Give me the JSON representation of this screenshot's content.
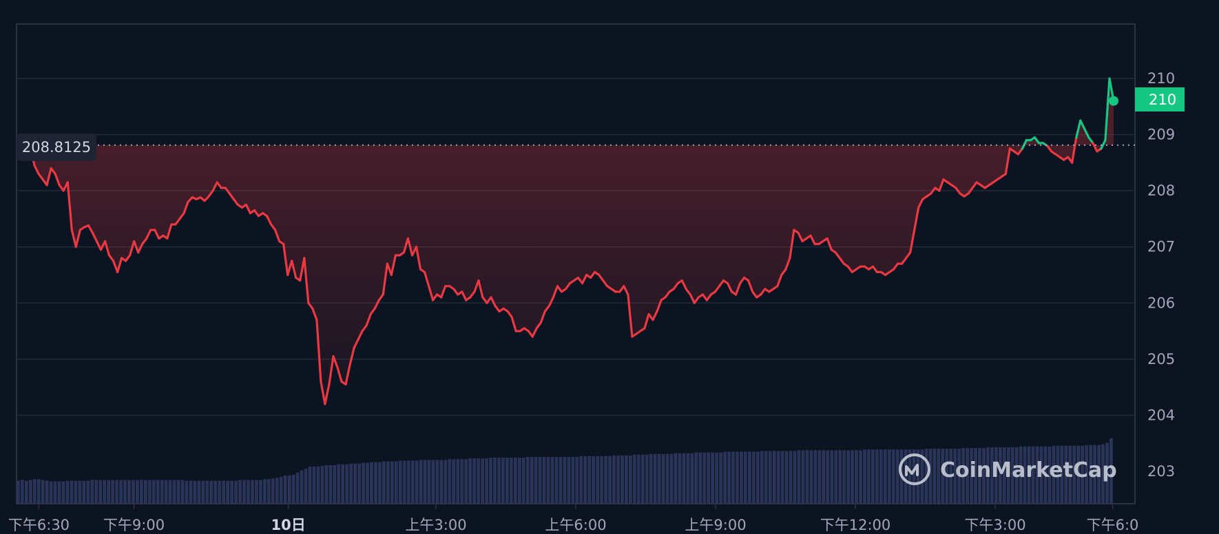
{
  "brand": {
    "name": "CoinMarketCap",
    "icon": "coinmarketcap-logo-icon"
  },
  "colors": {
    "background": "#0d1421",
    "grid": "#222a3a",
    "up": "#16c784",
    "down": "#ea3943",
    "volume": "#2a3358",
    "reference": "#a1a7bb",
    "label_bg": "#1e2433"
  },
  "chart_data": {
    "type": "line",
    "reference_value": 208.8125,
    "reference_label": "208.8125",
    "last_value": 209.6,
    "last_label": "210",
    "ylim": [
      202.4,
      210.9
    ],
    "yticks": [
      203,
      204,
      205,
      206,
      207,
      208,
      209,
      210
    ],
    "ytick_labels": [
      "203",
      "204",
      "205",
      "206",
      "207",
      "208",
      "209",
      "210"
    ],
    "x_tick_labels": [
      {
        "label": "下午6:30",
        "pos": 0.02,
        "bold": false
      },
      {
        "label": "下午9:00",
        "pos": 0.105,
        "bold": false
      },
      {
        "label": "10日",
        "pos": 0.243,
        "bold": true
      },
      {
        "label": "上午3:00",
        "pos": 0.375,
        "bold": false
      },
      {
        "label": "上午6:00",
        "pos": 0.5,
        "bold": false
      },
      {
        "label": "上午9:00",
        "pos": 0.625,
        "bold": false
      },
      {
        "label": "下午12:00",
        "pos": 0.75,
        "bold": false
      },
      {
        "label": "下午3:00",
        "pos": 0.875,
        "bold": false
      },
      {
        "label": "下午6:0",
        "pos": 0.98,
        "bold": false
      }
    ],
    "series": [
      {
        "values": [
          208.8,
          208.45,
          208.3,
          208.2,
          208.1,
          208.4,
          208.3,
          208.1,
          208.0,
          208.15,
          207.3,
          207.0,
          207.3,
          207.35,
          207.38,
          207.25,
          207.1,
          206.95,
          207.1,
          206.85,
          206.75,
          206.55,
          206.8,
          206.75,
          206.85,
          207.1,
          206.9,
          207.05,
          207.15,
          207.3,
          207.3,
          207.15,
          207.2,
          207.15,
          207.4,
          207.4,
          207.5,
          207.6,
          207.8,
          207.88,
          207.85,
          207.88,
          207.82,
          207.9,
          208.0,
          208.15,
          208.05,
          208.05,
          207.95,
          207.85,
          207.75,
          207.7,
          207.75,
          207.6,
          207.65,
          207.55,
          207.6,
          207.55,
          207.4,
          207.3,
          207.1,
          207.05,
          206.5,
          206.75,
          206.45,
          206.4,
          206.8,
          206.0,
          205.9,
          205.7,
          204.6,
          204.2,
          204.55,
          205.05,
          204.85,
          204.6,
          204.55,
          204.9,
          205.2,
          205.35,
          205.5,
          205.6,
          205.8,
          205.9,
          206.05,
          206.15,
          206.7,
          206.5,
          206.85,
          206.85,
          206.9,
          207.15,
          206.85,
          207.0,
          206.6,
          206.55,
          206.3,
          206.05,
          206.15,
          206.1,
          206.3,
          206.3,
          206.25,
          206.15,
          206.2,
          206.05,
          206.1,
          206.2,
          206.4,
          206.1,
          206.0,
          206.1,
          205.95,
          205.85,
          205.9,
          205.85,
          205.75,
          205.5,
          205.5,
          205.55,
          205.5,
          205.4,
          205.55,
          205.65,
          205.85,
          205.95,
          206.1,
          206.3,
          206.2,
          206.25,
          206.35,
          206.4,
          206.45,
          206.35,
          206.5,
          206.45,
          206.55,
          206.5,
          206.4,
          206.3,
          206.25,
          206.2,
          206.2,
          206.3,
          206.15,
          205.4,
          205.45,
          205.5,
          205.55,
          205.8,
          205.7,
          205.85,
          206.05,
          206.1,
          206.2,
          206.25,
          206.35,
          206.4,
          206.25,
          206.15,
          206.0,
          206.1,
          206.15,
          206.05,
          206.15,
          206.2,
          206.3,
          206.4,
          206.35,
          206.2,
          206.15,
          206.35,
          206.45,
          206.4,
          206.2,
          206.1,
          206.15,
          206.25,
          206.2,
          206.25,
          206.3,
          206.5,
          206.6,
          206.8,
          207.3,
          207.25,
          207.1,
          207.15,
          207.2,
          207.05,
          207.05,
          207.1,
          207.15,
          206.95,
          206.9,
          206.8,
          206.7,
          206.65,
          206.55,
          206.6,
          206.65,
          206.65,
          206.6,
          206.65,
          206.55,
          206.55,
          206.5,
          206.55,
          206.6,
          206.7,
          206.7,
          206.8,
          206.9,
          207.3,
          207.7,
          207.85,
          207.9,
          207.95,
          208.05,
          208.0,
          208.2,
          208.15,
          208.1,
          208.05,
          207.95,
          207.9,
          207.95,
          208.05,
          208.15,
          208.1,
          208.05,
          208.1,
          208.15,
          208.2,
          208.25,
          208.3,
          208.75,
          208.7,
          208.65,
          208.75,
          208.9,
          208.9,
          208.95,
          208.85,
          208.85,
          208.8,
          208.7,
          208.65,
          208.6,
          208.55,
          208.6,
          208.5,
          208.95,
          209.25,
          209.1,
          208.95,
          208.85,
          208.7,
          208.75,
          208.9,
          210.0,
          209.6
        ]
      }
    ],
    "volume": [
      0.31,
      0.32,
      0.31,
      0.32,
      0.33,
      0.33,
      0.32,
      0.31,
      0.3,
      0.3,
      0.3,
      0.3,
      0.31,
      0.31,
      0.31,
      0.31,
      0.31,
      0.31,
      0.32,
      0.32,
      0.32,
      0.32,
      0.32,
      0.32,
      0.32,
      0.32,
      0.32,
      0.32,
      0.32,
      0.32,
      0.32,
      0.32,
      0.32,
      0.32,
      0.32,
      0.32,
      0.32,
      0.32,
      0.32,
      0.32,
      0.32,
      0.31,
      0.31,
      0.31,
      0.31,
      0.31,
      0.31,
      0.31,
      0.31,
      0.31,
      0.31,
      0.31,
      0.31,
      0.31,
      0.32,
      0.32,
      0.32,
      0.32,
      0.32,
      0.32,
      0.33,
      0.33,
      0.34,
      0.35,
      0.36,
      0.38,
      0.38,
      0.39,
      0.42,
      0.45,
      0.47,
      0.5,
      0.5,
      0.5,
      0.51,
      0.52,
      0.52,
      0.52,
      0.53,
      0.53,
      0.53,
      0.54,
      0.54,
      0.54,
      0.55,
      0.55,
      0.56,
      0.56,
      0.56,
      0.57,
      0.57,
      0.57,
      0.57,
      0.58,
      0.58,
      0.58,
      0.58,
      0.58,
      0.59,
      0.59,
      0.59,
      0.59,
      0.59,
      0.59,
      0.59,
      0.6,
      0.6,
      0.6,
      0.6,
      0.6,
      0.61,
      0.61,
      0.61,
      0.61,
      0.61,
      0.62,
      0.62,
      0.62,
      0.62,
      0.62,
      0.62,
      0.62,
      0.62,
      0.62,
      0.63,
      0.63,
      0.63,
      0.63,
      0.63,
      0.63,
      0.63,
      0.63,
      0.63,
      0.63,
      0.63,
      0.63,
      0.63,
      0.64,
      0.64,
      0.64,
      0.64,
      0.64,
      0.64,
      0.64,
      0.64,
      0.65,
      0.65,
      0.65,
      0.65,
      0.65,
      0.66,
      0.66,
      0.66,
      0.66,
      0.67,
      0.67,
      0.67,
      0.67,
      0.67,
      0.67,
      0.68,
      0.68,
      0.68,
      0.68,
      0.68,
      0.69,
      0.69,
      0.69,
      0.69,
      0.69,
      0.69,
      0.69,
      0.7,
      0.7,
      0.7,
      0.7,
      0.7,
      0.7,
      0.7,
      0.7,
      0.7,
      0.71,
      0.71,
      0.71,
      0.71,
      0.71,
      0.71,
      0.71,
      0.71,
      0.71,
      0.72,
      0.72,
      0.72,
      0.72,
      0.72,
      0.72,
      0.72,
      0.72,
      0.72,
      0.72,
      0.72,
      0.72,
      0.72,
      0.72,
      0.72,
      0.72,
      0.73,
      0.73,
      0.73,
      0.73,
      0.73,
      0.73,
      0.73,
      0.73,
      0.73,
      0.73,
      0.73,
      0.73,
      0.73,
      0.73,
      0.73,
      0.74,
      0.74,
      0.74,
      0.74,
      0.74,
      0.74,
      0.74,
      0.74,
      0.74,
      0.75,
      0.75,
      0.75,
      0.75,
      0.75,
      0.75,
      0.76,
      0.76,
      0.76,
      0.76,
      0.76,
      0.76,
      0.76,
      0.76,
      0.77,
      0.77,
      0.77,
      0.77,
      0.77,
      0.77,
      0.77,
      0.77,
      0.78,
      0.78,
      0.78,
      0.78,
      0.78,
      0.78,
      0.78,
      0.78,
      0.79,
      0.79,
      0.79,
      0.79,
      0.8,
      0.82,
      0.88
    ]
  }
}
